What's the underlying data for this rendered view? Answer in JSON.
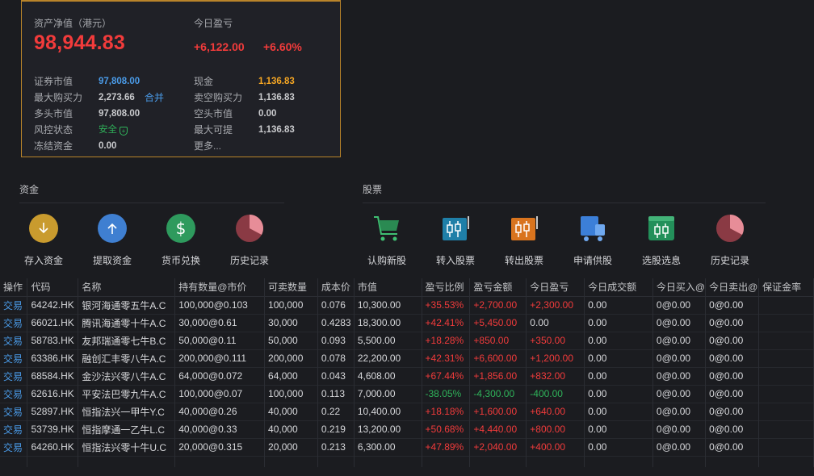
{
  "summary": {
    "nav_label": "资产净值（港元）",
    "nav_value": "98,944.83",
    "pnl_label": "今日盈亏",
    "pnl_amount": "+6,122.00",
    "pnl_percent": "+6.60%",
    "left": [
      {
        "label": "证券市值",
        "value": "97,808.00"
      },
      {
        "label": "最大购买力",
        "value": "2,273.66",
        "extra": "合并"
      },
      {
        "label": "多头市值",
        "value": "97,808.00"
      },
      {
        "label": "风控状态",
        "value": "安全"
      },
      {
        "label": "冻结资金",
        "value": "0.00"
      }
    ],
    "right": [
      {
        "label": "现金",
        "value": "1,136.83"
      },
      {
        "label": "卖空购买力",
        "value": "1,136.83"
      },
      {
        "label": "空头市值",
        "value": "0.00"
      },
      {
        "label": "最大可提",
        "value": "1,136.83"
      }
    ],
    "more_link": "更多..."
  },
  "funds": {
    "title": "资金",
    "actions": [
      "存入资金",
      "提取资金",
      "货币兑换",
      "历史记录"
    ]
  },
  "stocks": {
    "title": "股票",
    "actions": [
      "认购新股",
      "转入股票",
      "转出股票",
      "申请供股",
      "选股选息",
      "历史记录"
    ]
  },
  "table": {
    "headers": [
      "操作",
      "代码",
      "名称",
      "持有数量@市价",
      "可卖数量",
      "成本价",
      "市值",
      "盈亏比例",
      "盈亏金额",
      "今日盈亏",
      "今日成交额",
      "今日买入@",
      "今日卖出@",
      "保证金率"
    ],
    "rows": [
      [
        "交易",
        "64242.HK",
        "银河海通零五牛A.C",
        "100,000@0.103",
        "100,000",
        "0.076",
        "10,300.00",
        "+35.53%",
        "+2,700.00",
        "+2,300.00",
        "0.00",
        "0@0.00",
        "0@0.00",
        ""
      ],
      [
        "交易",
        "66021.HK",
        "腾讯海通零十牛A.C",
        "30,000@0.61",
        "30,000",
        "0.4283",
        "18,300.00",
        "+42.41%",
        "+5,450.00",
        "0.00",
        "0.00",
        "0@0.00",
        "0@0.00",
        ""
      ],
      [
        "交易",
        "58783.HK",
        "友邦瑞通零七牛B.C",
        "50,000@0.11",
        "50,000",
        "0.093",
        "5,500.00",
        "+18.28%",
        "+850.00",
        "+350.00",
        "0.00",
        "0@0.00",
        "0@0.00",
        ""
      ],
      [
        "交易",
        "63386.HK",
        "融创汇丰零八牛A.C",
        "200,000@0.111",
        "200,000",
        "0.078",
        "22,200.00",
        "+42.31%",
        "+6,600.00",
        "+1,200.00",
        "0.00",
        "0@0.00",
        "0@0.00",
        ""
      ],
      [
        "交易",
        "68584.HK",
        "金沙法兴零八牛A.C",
        "64,000@0.072",
        "64,000",
        "0.043",
        "4,608.00",
        "+67.44%",
        "+1,856.00",
        "+832.00",
        "0.00",
        "0@0.00",
        "0@0.00",
        ""
      ],
      [
        "交易",
        "62616.HK",
        "平安法巴零九牛A.C",
        "100,000@0.07",
        "100,000",
        "0.113",
        "7,000.00",
        "-38.05%",
        "-4,300.00",
        "-400.00",
        "0.00",
        "0@0.00",
        "0@0.00",
        ""
      ],
      [
        "交易",
        "52897.HK",
        "恒指法兴一甲牛Y.C",
        "40,000@0.26",
        "40,000",
        "0.22",
        "10,400.00",
        "+18.18%",
        "+1,600.00",
        "+640.00",
        "0.00",
        "0@0.00",
        "0@0.00",
        ""
      ],
      [
        "交易",
        "53739.HK",
        "恒指摩通一乙牛L.C",
        "40,000@0.33",
        "40,000",
        "0.219",
        "13,200.00",
        "+50.68%",
        "+4,440.00",
        "+800.00",
        "0.00",
        "0@0.00",
        "0@0.00",
        ""
      ],
      [
        "交易",
        "64260.HK",
        "恒指法兴零十牛U.C",
        "20,000@0.315",
        "20,000",
        "0.213",
        "6,300.00",
        "+47.89%",
        "+2,040.00",
        "+400.00",
        "0.00",
        "0@0.00",
        "0@0.00",
        ""
      ]
    ]
  }
}
